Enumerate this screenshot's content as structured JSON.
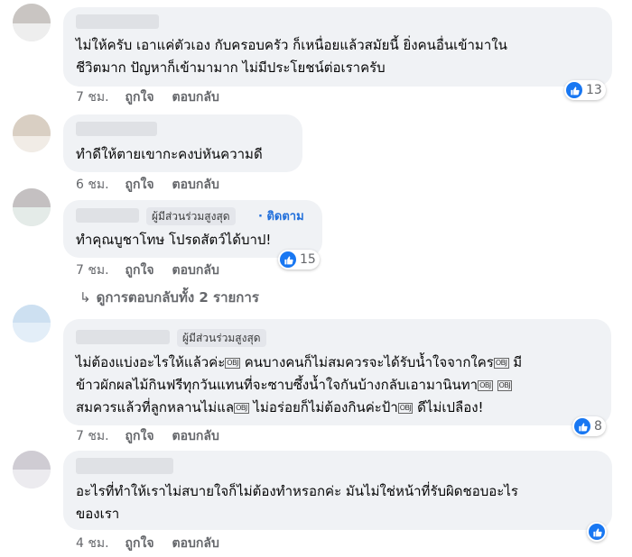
{
  "comments": [
    {
      "text_lines": [
        "ไม่ให้ครับ เอาแค่ตัวเอง กับครอบครัว ก็เหนื่อยแล้วสมัยนี้ ยิ่งคนอื่นเข้ามาใน",
        "ชีวิตมาก ปัญหาก็เข้ามามาก ไม่มีประโยชน์ต่อเราครับ"
      ],
      "time": "7 ชม.",
      "like": "ถูกใจ",
      "reply": "ตอบกลับ",
      "reactions": "13"
    },
    {
      "text_lines": [
        "ทำดีให้ตายเขากะคงบ่หันความดี"
      ],
      "time": "6 ชม.",
      "like": "ถูกใจ",
      "reply": "ตอบกลับ"
    },
    {
      "badge": "ผู้มีส่วนร่วมสูงสุด",
      "follow": "· ติดตาม",
      "text_lines": [
        "ทำคุณบูชาโทษ โปรดสัตว์ได้บาป!"
      ],
      "time": "7 ชม.",
      "like": "ถูกใจ",
      "reply": "ตอบกลับ",
      "reactions": "15",
      "view_replies": "ดูการตอบกลับทั้ง 2 รายการ"
    },
    {
      "badge": "ผู้มีส่วนร่วมสูงสุด",
      "text_segments": {
        "l1a": "ไม่ต้องแบ่งอะไรให้แล้วค่ะ",
        "l1b": " คนบางคนก็ไม่สมควรจะได้รับน้ำใจจากใคร",
        "l1c": " มี",
        "l2a": "ข้าวผักผลไม้กินฟรีทุกวันแทนที่จะซาบซึ้งน้ำใจกันบ้างกลับเอามานินทา",
        "l3a": "สมควรแล้วที่ลูกหลานไม่แล",
        "l3b": " ไม่อร่อยก็ไม่ต้องกินค่ะป้า",
        "l3c": " ดีไม่เปลือง!"
      },
      "obj_glyph": "OBJ",
      "time": "7 ชม.",
      "like": "ถูกใจ",
      "reply": "ตอบกลับ",
      "reactions": "8"
    },
    {
      "text_lines": [
        "อะไรที่ทำให้เราไม่สบายใจก็ไม่ต้องทำหรอกค่ะ มันไม่ใช่หน้าที่รับผิดชอบอะไร",
        "ของเรา"
      ],
      "time": "4 ชม.",
      "like": "ถูกใจ",
      "reply": "ตอบกลับ"
    }
  ],
  "colors": {
    "bubble": "#f0f2f5",
    "meta_text": "#65676b",
    "accent_blue": "#1877f2",
    "follow_blue": "#216fdb"
  },
  "icons": {
    "reaction": "like-icon",
    "reply_arrow": "reply-arrow-icon"
  }
}
